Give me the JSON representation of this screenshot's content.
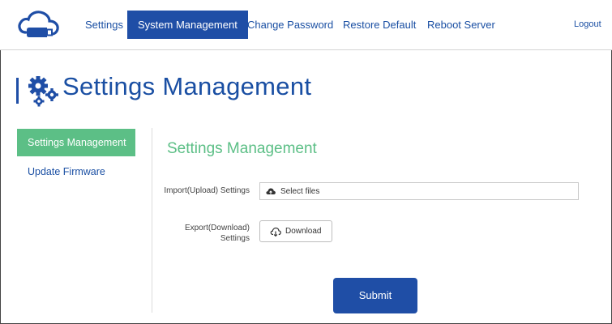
{
  "nav": {
    "settings": "Settings",
    "system_management": "System Management",
    "change_password": "Change Password",
    "restore_default": "Restore Default",
    "reboot_server": "Reboot Server",
    "logout": "Logout"
  },
  "page": {
    "title": "Settings Management"
  },
  "sidebar": {
    "items": [
      {
        "label": "Settings Management",
        "active": true
      },
      {
        "label": "Update Firmware",
        "active": false
      }
    ]
  },
  "content": {
    "section_title": "Settings Management",
    "import_label": "Import(Upload) Settings",
    "select_files": "Select files",
    "export_label_line1": "Export(Download)",
    "export_label_line2": "Settings",
    "download_label": "Download",
    "submit_label": "Submit"
  },
  "icons": {
    "logo": "cloud-usb-icon",
    "title": "gears-icon",
    "select_files": "cloud-upload-icon",
    "download": "cloud-download-icon"
  },
  "colors": {
    "brand_blue": "#1f4ea6",
    "accent_green": "#5cbf86"
  }
}
